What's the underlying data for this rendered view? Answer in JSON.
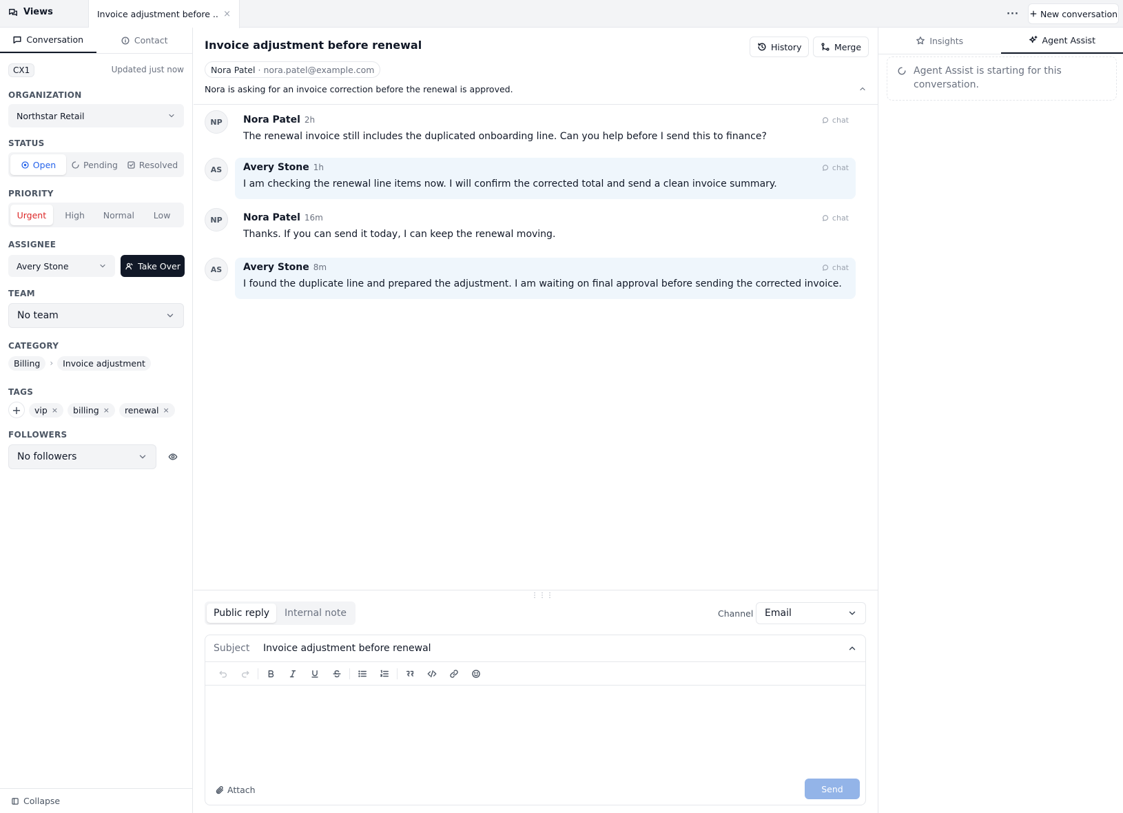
{
  "topbar": {
    "views_label": "Views",
    "active_tab_title": "Invoice adjustment before ...",
    "close_symbol": "×",
    "more_symbol": "···",
    "new_conversation": "New conversation"
  },
  "left": {
    "tabs": [
      {
        "label": "Conversation",
        "icon": "chat-icon",
        "active": true
      },
      {
        "label": "Contact",
        "icon": "info-icon",
        "active": false
      }
    ],
    "conversation_id": "CX1",
    "updated": "Updated just now",
    "organization": {
      "label": "ORGANIZATION",
      "value": "Northstar Retail"
    },
    "status": {
      "label": "STATUS",
      "options": [
        "Open",
        "Pending",
        "Resolved"
      ],
      "selected": "Open"
    },
    "priority": {
      "label": "PRIORITY",
      "options": [
        "Urgent",
        "High",
        "Normal",
        "Low"
      ],
      "selected": "Urgent"
    },
    "assignee": {
      "label": "ASSIGNEE",
      "value": "Avery Stone",
      "take_over": "Take Over"
    },
    "team": {
      "label": "TEAM",
      "value": "No team"
    },
    "category": {
      "label": "CATEGORY",
      "parent": "Billing",
      "separator": "›",
      "child": "Invoice adjustment"
    },
    "tags": {
      "label": "TAGS",
      "add_symbol": "+",
      "items": [
        "vip",
        "billing",
        "renewal"
      ],
      "remove_symbol": "×"
    },
    "followers": {
      "label": "FOLLOWERS",
      "value": "No followers"
    },
    "collapse": "Collapse"
  },
  "center": {
    "title": "Invoice adjustment before renewal",
    "history": "History",
    "merge": "Merge",
    "contact_name": "Nora Patel",
    "contact_sep": "·",
    "contact_email": "nora.patel@example.com",
    "summary": "Nora is asking for an invoice correction before the renewal is approved.",
    "messages": [
      {
        "initials": "NP",
        "name": "Nora Patel",
        "time": "2h",
        "channel": "chat",
        "role": "customer",
        "text": "The renewal invoice still includes the duplicated onboarding line. Can you help before I send this to finance?"
      },
      {
        "initials": "AS",
        "name": "Avery Stone",
        "time": "1h",
        "channel": "chat",
        "role": "agent",
        "text": "I am checking the renewal line items now. I will confirm the corrected total and send a clean invoice summary."
      },
      {
        "initials": "NP",
        "name": "Nora Patel",
        "time": "16m",
        "channel": "chat",
        "role": "customer",
        "text": "Thanks. If you can send it today, I can keep the renewal moving."
      },
      {
        "initials": "AS",
        "name": "Avery Stone",
        "time": "8m",
        "channel": "chat",
        "role": "agent",
        "text": "I found the duplicate line and prepared the adjustment. I am waiting on final approval before sending the corrected invoice."
      }
    ],
    "composer": {
      "reply_tabs": [
        "Public reply",
        "Internal note"
      ],
      "active_reply_tab": "Public reply",
      "channel_label": "Channel",
      "channel_value": "Email",
      "subject_label": "Subject",
      "subject_value": "Invoice adjustment before renewal",
      "attach": "Attach",
      "send": "Send"
    }
  },
  "right": {
    "tabs": [
      {
        "label": "Insights",
        "icon": "star-icon",
        "active": false
      },
      {
        "label": "Agent Assist",
        "icon": "sparkle-icon",
        "active": true
      }
    ],
    "assist_status": "Agent Assist is starting for this conversation."
  },
  "colors": {
    "accent_blue": "#2563eb",
    "urgent_red": "#dc2626",
    "agent_bubble": "#eff6fc",
    "dark_button": "#111827",
    "send_disabled": "#93b4e8"
  }
}
